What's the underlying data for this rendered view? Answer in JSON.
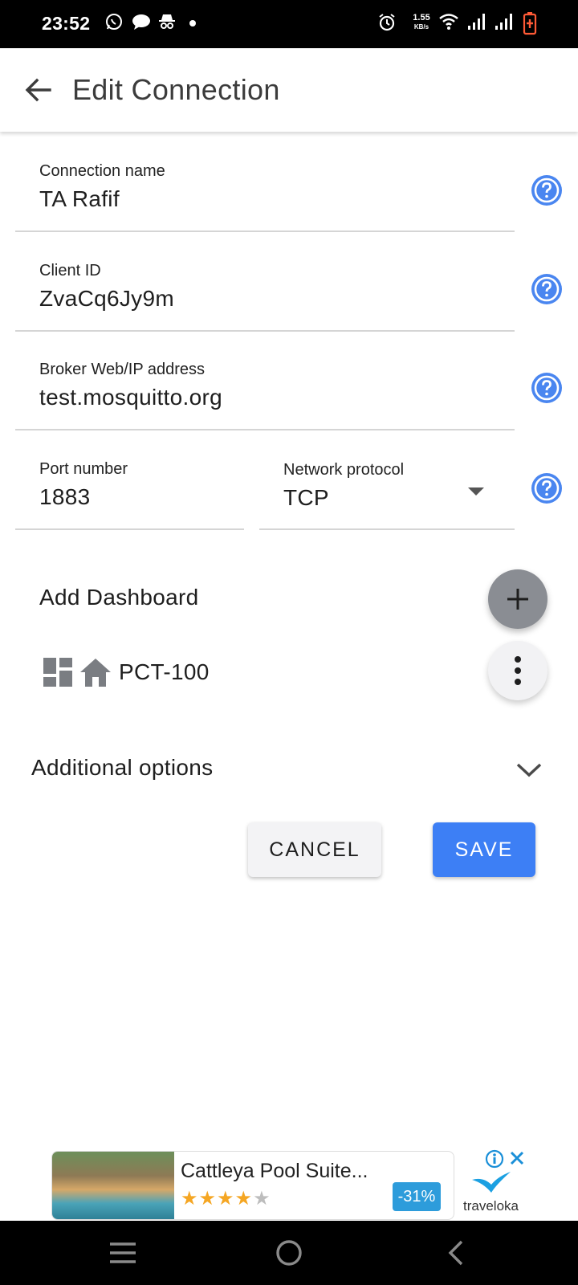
{
  "status_bar": {
    "time": "23:52",
    "net_speed_value": "1.55",
    "net_speed_unit": "KB/s",
    "left_icons": [
      "whatsapp-icon",
      "message-icon",
      "incognito-icon",
      "dot-icon"
    ],
    "right_icons": [
      "alarm-icon",
      "wifi-icon",
      "signal-icon",
      "signal-icon",
      "battery-icon"
    ]
  },
  "app_bar": {
    "title": "Edit Connection"
  },
  "form": {
    "connection_name": {
      "label": "Connection name",
      "value": "TA Rafif"
    },
    "client_id": {
      "label": "Client ID",
      "value": "ZvaCq6Jy9m"
    },
    "broker": {
      "label": "Broker Web/IP address",
      "value": "test.mosquitto.org"
    },
    "port": {
      "label": "Port number",
      "value": "1883"
    },
    "protocol": {
      "label": "Network protocol",
      "value": "TCP"
    }
  },
  "dashboards": {
    "heading": "Add Dashboard",
    "items": [
      {
        "name": "PCT-100"
      }
    ]
  },
  "additional_options": {
    "label": "Additional options"
  },
  "actions": {
    "cancel_label": "CANCEL",
    "save_label": "SAVE"
  },
  "ad": {
    "title": "Cattleya Pool Suite...",
    "rating": 4,
    "rating_max": 5,
    "discount": "-31%",
    "brand": "traveloka"
  },
  "colors": {
    "accent": "#3d7ff5",
    "help": "#4a86f0",
    "fab": "#8a8d93"
  }
}
